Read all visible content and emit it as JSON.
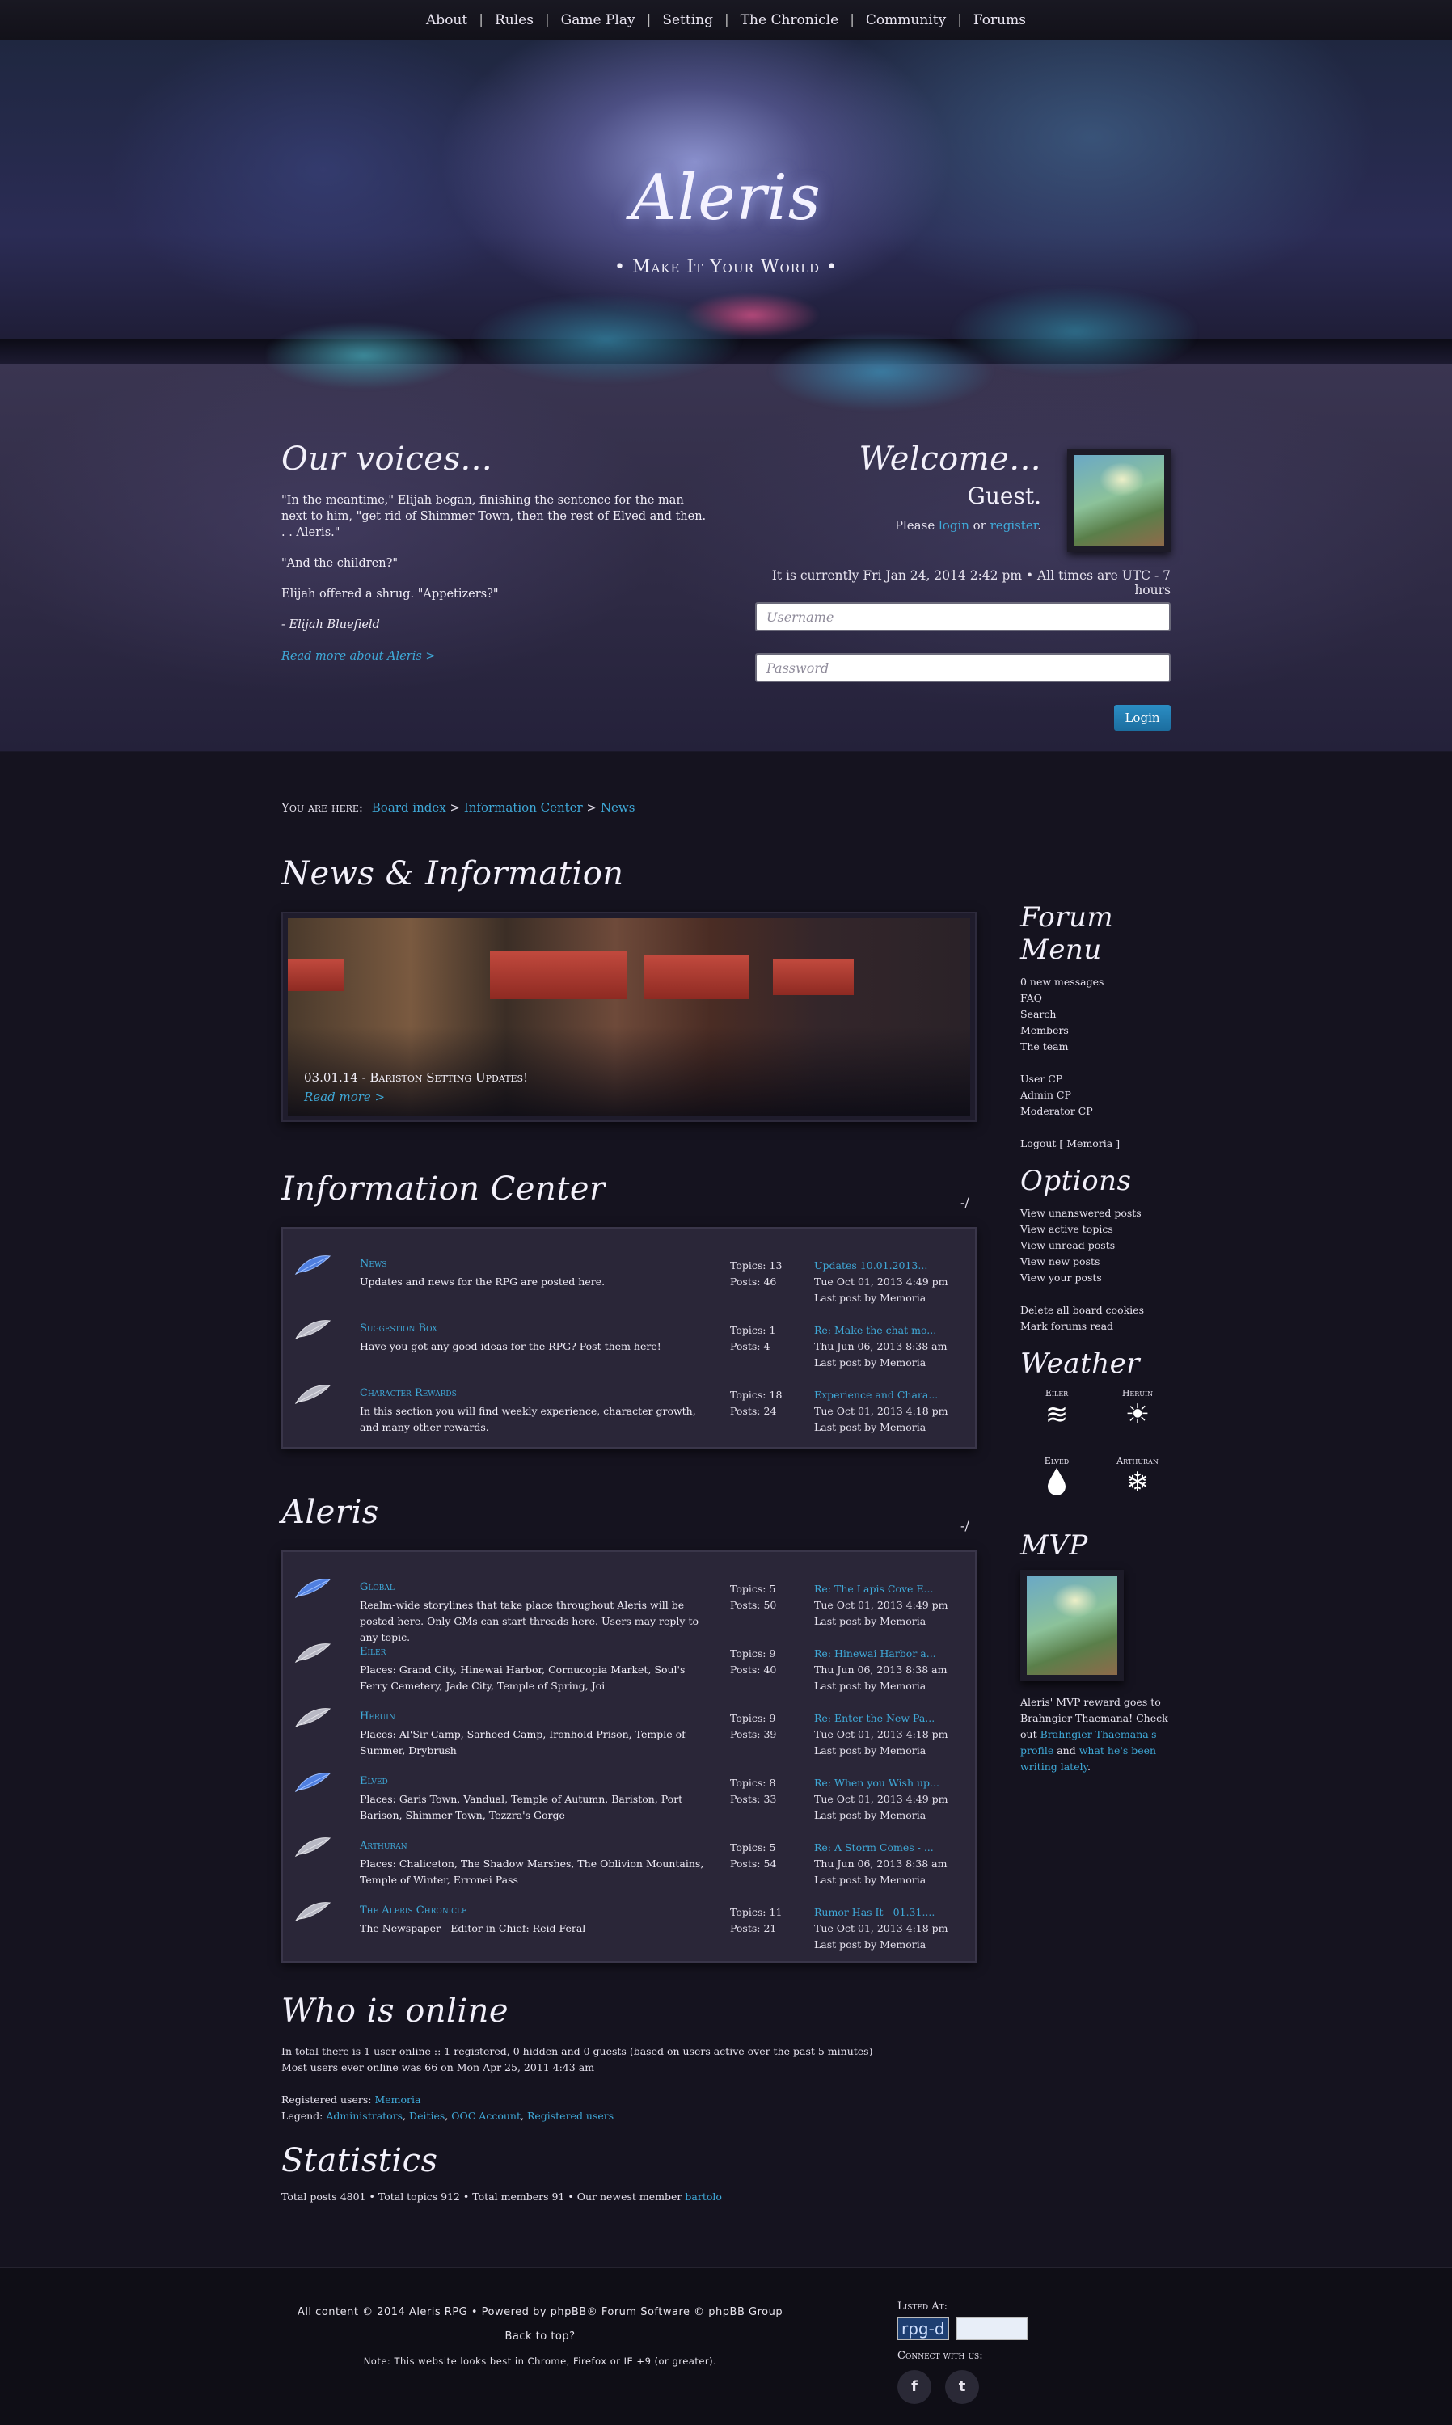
{
  "nav": [
    "About",
    "Rules",
    "Game Play",
    "Setting",
    "The Chronicle",
    "Community",
    "Forums"
  ],
  "header": {
    "title": "Aleris",
    "tagline": "• Make It Your World •"
  },
  "voices": {
    "title": "Our voices...",
    "quote1": "\"In the meantime,\" Elijah began, finishing the sentence for the man next to him, \"get rid of Shimmer Town, then the rest of Elved and then. . . Aleris.\"",
    "quote2": "\"And the children?\"",
    "quote3": "Elijah offered a shrug. \"Appetizers?\"",
    "attribution": "- Elijah Bluefield",
    "readmore": "Read more about Aleris >"
  },
  "welcome": {
    "line1": "Welcome...",
    "line2": "Guest.",
    "please": "Please",
    "login_link": "login",
    "or": "or",
    "register_link": "register",
    "period": ".",
    "time": "It is currently Fri Jan 24, 2014 2:42 pm  •  All times are UTC - 7 hours",
    "username_placeholder": "Username",
    "password_placeholder": "Password",
    "login_button": "Login"
  },
  "breadcrumb": {
    "label": "You are here:",
    "items": [
      "Board index",
      "Information Center",
      "News"
    ],
    "sep": ">"
  },
  "news": {
    "title": "News & Information",
    "caption": "03.01.14 - Bariston Setting Updates!",
    "readmore": "Read more >"
  },
  "info_center": {
    "title": "Information Center",
    "toggle": "-/",
    "forums": [
      {
        "name": "News",
        "desc": "Updates and news for the RPG are posted here.",
        "topics": "Topics: 13",
        "posts": "Posts: 46",
        "last_title": "Updates 10.01.2013...",
        "last_date": "Tue Oct 01, 2013 4:49 pm",
        "last_by": "Last post by Memoria",
        "icon": "blue-feather-icon"
      },
      {
        "name": "Suggestion Box",
        "desc": "Have you got any good ideas for the RPG? Post them here!",
        "topics": "Topics: 1",
        "posts": "Posts: 4",
        "last_title": "Re: Make the chat mo...",
        "last_date": "Thu Jun 06, 2013 8:38 am",
        "last_by": "Last post by Memoria",
        "icon": "grey-feather-icon"
      },
      {
        "name": "Character Rewards",
        "desc": "In this section you will find weekly experience, character growth, and many other rewards.",
        "topics": "Topics: 18",
        "posts": "Posts: 24",
        "last_title": "Experience and Chara...",
        "last_date": "Tue Oct 01, 2013 4:18 pm",
        "last_by": "Last post by Memoria",
        "icon": "grey-feather-icon"
      }
    ]
  },
  "aleris": {
    "title": "Aleris",
    "toggle": "-/",
    "forums": [
      {
        "name": "Global",
        "desc": "Realm-wide storylines that take place throughout Aleris will be posted here. Only GMs can start threads here. Users may reply to any topic.",
        "topics": "Topics: 5",
        "posts": "Posts: 50",
        "last_title": "Re: The Lapis Cove E...",
        "last_date": "Tue Oct 01, 2013 4:49 pm",
        "last_by": "Last post by Memoria",
        "icon": "blue-feather-icon"
      },
      {
        "name": "Eiler",
        "desc": "Places: Grand City, Hinewai Harbor, Cornucopia Market, Soul's Ferry Cemetery, Jade City, Temple of Spring, Joi",
        "topics": "Topics: 9",
        "posts": "Posts: 40",
        "last_title": "Re: Hinewai Harbor a...",
        "last_date": "Thu Jun 06, 2013 8:38 am",
        "last_by": "Last post by Memoria",
        "icon": "grey-feather-icon"
      },
      {
        "name": "Heruin",
        "desc": "Places: Al'Sir Camp, Sarheed Camp, Ironhold Prison, Temple of Summer, Drybrush",
        "topics": "Topics: 9",
        "posts": "Posts: 39",
        "last_title": "Re: Enter the New Pa...",
        "last_date": "Tue Oct 01, 2013 4:18 pm",
        "last_by": "Last post by Memoria",
        "icon": "grey-feather-icon"
      },
      {
        "name": "Elved",
        "desc": "Places: Garis Town, Vandual, Temple of Autumn, Bariston, Port Barison, Shimmer Town, Tezzra's Gorge",
        "topics": "Topics: 8",
        "posts": "Posts: 33",
        "last_title": "Re: When you Wish up...",
        "last_date": "Tue Oct 01, 2013 4:49 pm",
        "last_by": "Last post by Memoria",
        "icon": "blue-feather-icon"
      },
      {
        "name": "Arthuran",
        "desc": "Places: Chaliceton, The Shadow Marshes, The Oblivion Mountains, Temple of Winter, Erronei Pass",
        "topics": "Topics: 5",
        "posts": "Posts: 54",
        "last_title": "Re: A Storm Comes - ...",
        "last_date": "Thu Jun 06, 2013 8:38 am",
        "last_by": "Last post by Memoria",
        "icon": "grey-feather-icon"
      },
      {
        "name": "The Aleris Chronicle",
        "desc": "The Newspaper - Editor in Chief: Reid Feral",
        "topics": "Topics: 11",
        "posts": "Posts: 21",
        "last_title": "Rumor Has It - 01.31....",
        "last_date": "Tue Oct 01, 2013 4:18 pm",
        "last_by": "Last post by Memoria",
        "icon": "grey-feather-icon"
      }
    ]
  },
  "sidebar": {
    "menu_title": "Forum Menu",
    "menu1": [
      "0 new messages",
      "FAQ",
      "Search",
      "Members",
      "The team"
    ],
    "menu2": [
      "User CP",
      "Admin CP",
      "Moderator CP"
    ],
    "logout": "Logout [ Memoria ]",
    "options_title": "Options",
    "options1": [
      "View unanswered posts",
      "View active topics",
      "View unread posts",
      "View new posts",
      "View your posts"
    ],
    "options2": [
      "Delete all board cookies",
      "Mark forums read"
    ],
    "weather_title": "Weather",
    "weather": [
      {
        "region": "Eiler",
        "icon": "wind-icon",
        "glyph": "≋"
      },
      {
        "region": "Heruin",
        "icon": "sun-icon",
        "glyph": "☀"
      },
      {
        "region": "Elved",
        "icon": "raindrop-icon",
        "glyph": "💧"
      },
      {
        "region": "Arthuran",
        "icon": "snowflake-icon",
        "glyph": "❄"
      }
    ],
    "mvp_title": "MVP",
    "mvp_text1": "Aleris' MVP reward goes to Brahngier Thaemana! Check out",
    "mvp_link1": "Brahngier Thaemana's profile",
    "mvp_and": "and",
    "mvp_link2": "what he's been writing lately",
    "mvp_period": "."
  },
  "online": {
    "title": "Who is online",
    "line1": "In total there is 1 user online :: 1 registered, 0 hidden and 0 guests (based on users active over the past 5 minutes)",
    "line2": "Most users ever online was 66 on Mon Apr 25, 2011 4:43 am",
    "reg_label": "Registered users:",
    "reg_user": "Memoria",
    "legend_label": "Legend:",
    "legend": [
      "Administrators",
      "Deities",
      "OOC Account",
      "Registered users"
    ]
  },
  "statistics": {
    "title": "Statistics",
    "text": "Total posts 4801  •  Total topics 912  •  Total members 91  •  Our newest member",
    "newest": "bartolo"
  },
  "footer": {
    "copyright": "All content © 2014 Aleris RPG • Powered by phpBB® Forum Software © phpBB Group",
    "backtotop": "Back to top?",
    "note": "Note: This website looks best in Chrome, Firefox or IE +9 (or greater).",
    "listed_at": "Listed At:",
    "badge1": "rpg-d",
    "connect": "Connect with us:",
    "facebook": "f",
    "twitter": "t"
  },
  "colors": {
    "link": "#3fa9d8",
    "background": "#15131f",
    "panel": "#2a2638",
    "button": "#2b8ec4"
  }
}
